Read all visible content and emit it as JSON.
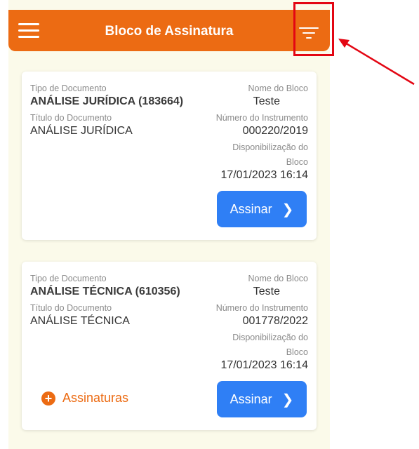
{
  "header": {
    "title": "Bloco de Assinatura",
    "menu_icon": "hamburger-menu-icon",
    "filter_icon": "filter-icon",
    "background_color": "#ec6b13"
  },
  "labels": {
    "doc_type": "Tipo de Documento",
    "doc_title": "Título do Documento",
    "block_name": "Nome do Bloco",
    "instrument_number": "Número do Instrumento",
    "availability_1": "Disponibilização do",
    "availability_2": "Bloco"
  },
  "cards": [
    {
      "doc_type": "ANÁLISE JURÍDICA (183664)",
      "doc_title": "ANÁLISE JURÍDICA",
      "block_name": "Teste",
      "instrument_number": "000220/2019",
      "availability_date": "17/01/2023 16:14",
      "sign_label": "Assinar"
    },
    {
      "doc_type": "ANÁLISE TÉCNICA (610356)",
      "doc_title": "ANÁLISE TÉCNICA",
      "block_name": "Teste",
      "instrument_number": "001778/2022",
      "availability_date": "17/01/2023 16:14",
      "sign_label": "Assinar",
      "signatures_label": "Assinaturas"
    }
  ],
  "colors": {
    "accent": "#ec6b13",
    "button": "#2f7ff5",
    "annotation": "#e30613"
  }
}
